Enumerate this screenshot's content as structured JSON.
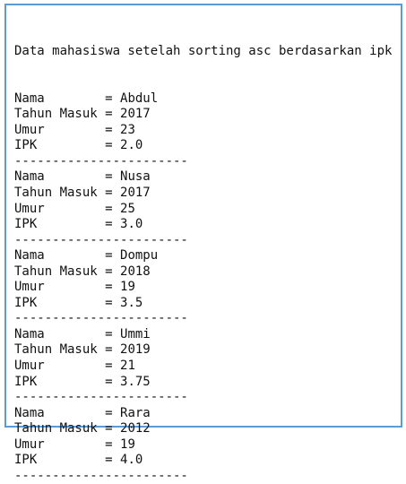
{
  "header": "Data mahasiswa setelah sorting asc berdasarkan ipk",
  "labels": {
    "nama": "Nama        = ",
    "tahun": "Tahun Masuk = ",
    "umur": "Umur        = ",
    "ipk": "IPK         = "
  },
  "separator": "-----------------------",
  "records": [
    {
      "nama": "Abdul",
      "tahun": "2017",
      "umur": "23",
      "ipk": "2.0"
    },
    {
      "nama": "Nusa",
      "tahun": "2017",
      "umur": "25",
      "ipk": "3.0"
    },
    {
      "nama": "Dompu",
      "tahun": "2018",
      "umur": "19",
      "ipk": "3.5"
    },
    {
      "nama": "Ummi",
      "tahun": "2019",
      "umur": "21",
      "ipk": "3.75"
    },
    {
      "nama": "Rara",
      "tahun": "2012",
      "umur": "19",
      "ipk": "4.0"
    }
  ]
}
